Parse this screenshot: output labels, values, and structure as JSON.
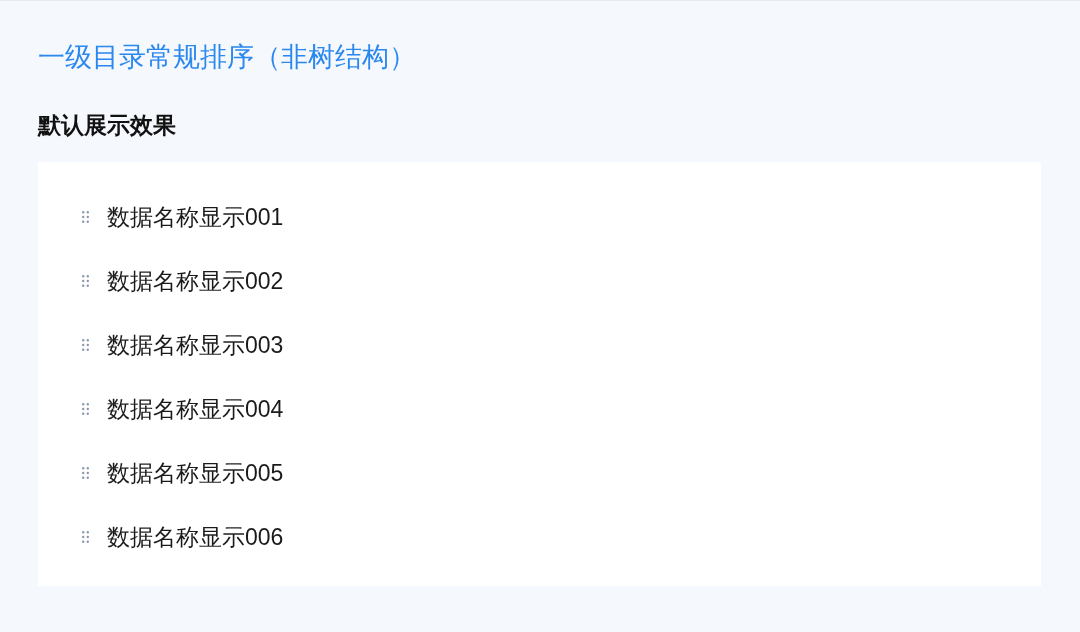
{
  "title": "一级目录常规排序（非树结构）",
  "section": {
    "heading": "默认展示效果",
    "items": [
      {
        "label": "数据名称显示001"
      },
      {
        "label": "数据名称显示002"
      },
      {
        "label": "数据名称显示003"
      },
      {
        "label": "数据名称显示004"
      },
      {
        "label": "数据名称显示005"
      },
      {
        "label": "数据名称显示006"
      }
    ]
  }
}
